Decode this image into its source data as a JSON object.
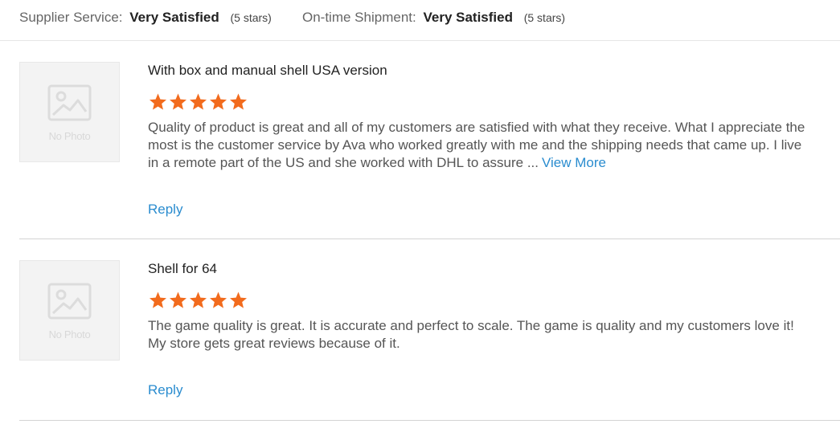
{
  "ratings": {
    "supplier": {
      "label": "Supplier Service:",
      "value": "Very Satisfied",
      "stars_text": "(5 stars)"
    },
    "shipment": {
      "label": "On-time Shipment:",
      "value": "Very Satisfied",
      "stars_text": "(5 stars)"
    }
  },
  "reviews": [
    {
      "thumbnail_text": "No Photo",
      "title": "With box and manual shell USA version",
      "rating": 5,
      "text": "Quality of product is great and all of my customers are satisfied with what they receive. What I appreciate the most is the customer service by Ava who worked greatly with me and the shipping needs that came up. I live in a remote part of the US and she worked with DHL to assure ...",
      "view_more": "View More",
      "reply": "Reply"
    },
    {
      "thumbnail_text": "No Photo",
      "title": "Shell for 64",
      "rating": 5,
      "text": "The game quality is great. It is accurate and perfect to scale. The game is quality and my customers love it! My store gets great reviews because of it.",
      "reply": "Reply"
    }
  ],
  "colors": {
    "star": "#f26b1d",
    "link": "#2a8ccf",
    "divider": "#d4d4d4"
  },
  "icons": {
    "thumbnail": "image-placeholder-icon",
    "star": "star-icon"
  }
}
